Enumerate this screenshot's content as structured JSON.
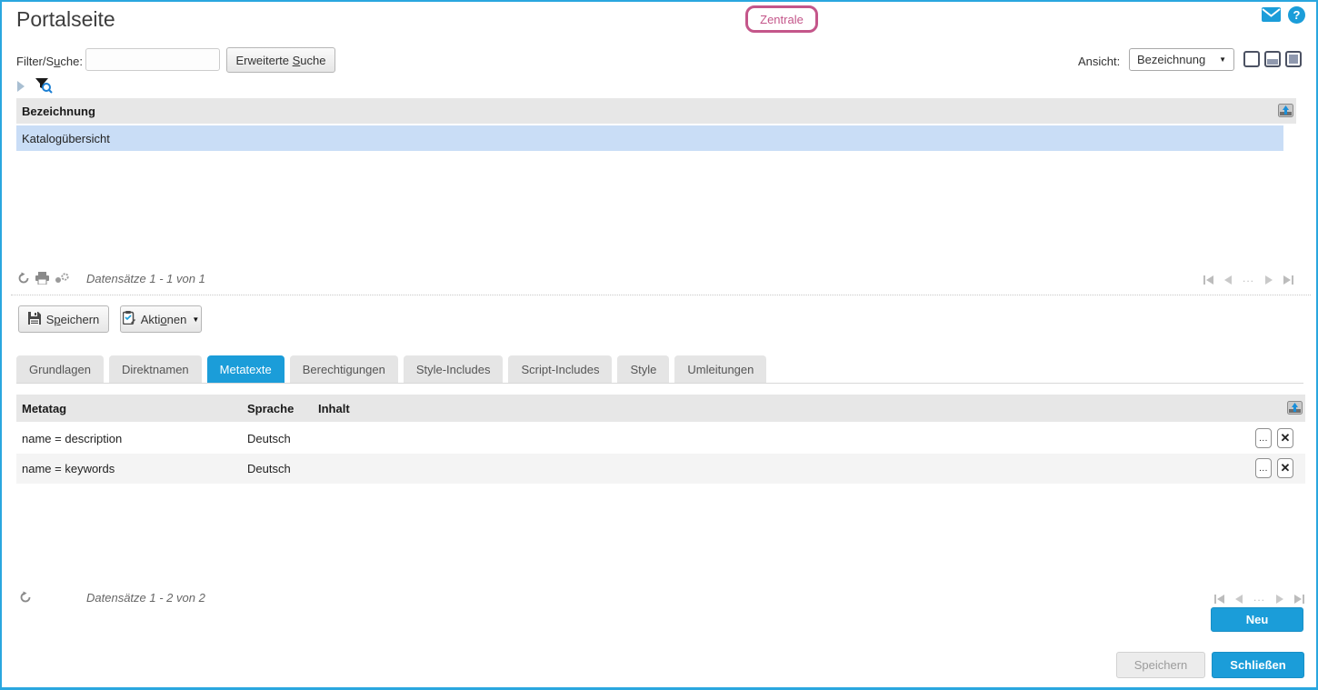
{
  "colors": {
    "accent_blue": "#1b9dd9",
    "frame_blue": "#2aa7df",
    "badge_pink": "#c4568a",
    "selected_row": "#c9ddf6",
    "table_header_bg": "#e7e7e7"
  },
  "header": {
    "title": "Portalseite",
    "badge_label": "Zentrale"
  },
  "toolbar": {
    "filter_label": {
      "pre": "Filter/S",
      "key": "u",
      "post": "che:"
    },
    "filter_value": "",
    "adv_search": {
      "pre": "Erweiterte ",
      "key": "S",
      "post": "uche"
    },
    "ansicht_label": "Ansicht:",
    "ansicht_value": "Bezeichnung"
  },
  "list_table": {
    "column_header": "Bezeichnung",
    "rows": [
      {
        "label": "Katalogübersicht"
      }
    ],
    "pager_text": "Datensätze 1 - 1 von 1"
  },
  "actions": {
    "speichern": {
      "pre": "S",
      "key": "p",
      "post": "eichern"
    },
    "aktionen": {
      "pre": "Akti",
      "key": "o",
      "post": "nen"
    }
  },
  "tabs": {
    "items": [
      "Grundlagen",
      "Direktnamen",
      "Metatexte",
      "Berechtigungen",
      "Style-Includes",
      "Script-Includes",
      "Style",
      "Umleitungen"
    ],
    "active": "Metatexte"
  },
  "detail_table": {
    "columns": {
      "metatag": "Metatag",
      "sprache": "Sprache",
      "inhalt": "Inhalt"
    },
    "rows": [
      {
        "metatag": "name = description",
        "sprache": "Deutsch",
        "inhalt": ""
      },
      {
        "metatag": "name = keywords",
        "sprache": "Deutsch",
        "inhalt": ""
      }
    ],
    "pager_text": "Datensätze 1 - 2 von 2"
  },
  "footer": {
    "neu": "Neu",
    "speichern": "Speichern",
    "schliessen": "Schließen"
  },
  "icons": {
    "dropdown_caret": "▼",
    "help_glyph": "?",
    "pager_ellipsis": "...",
    "row_more": "...",
    "row_delete": "✕"
  }
}
